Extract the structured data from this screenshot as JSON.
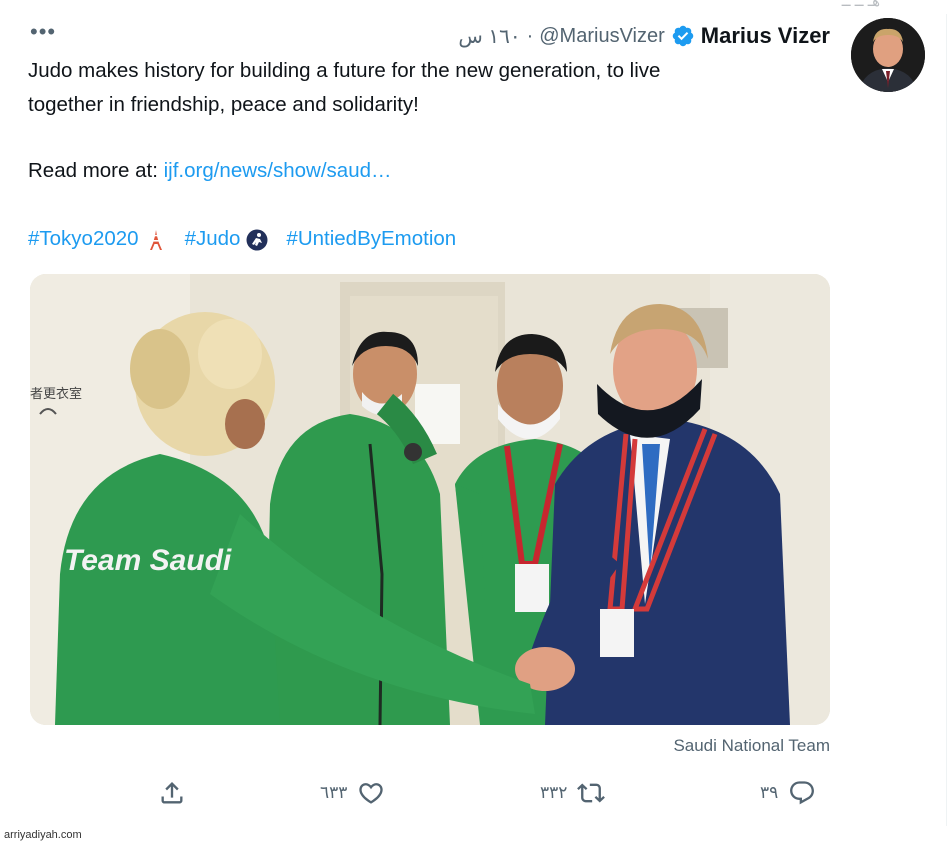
{
  "tweet": {
    "more_icon": "more-horizontal-icon",
    "display_name": "Marius Vizer",
    "verified_icon": "verified-badge-icon",
    "handle": "@MariusVizer",
    "separator": "·",
    "time": "١٦٠ س",
    "text_line1": "Judo makes history for building a future for the new generation, to live",
    "text_line2": "together in friendship, peace and solidarity!",
    "read_more_label": "Read more at:",
    "read_more_link": "ijf.org/news/show/saud…",
    "hashtags": [
      {
        "text": "#Tokyo2020",
        "emoji": "tokyo-tower-emoji"
      },
      {
        "text": "#Judo",
        "emoji": "judo-emoji"
      },
      {
        "text": "#UntiedByEmotion",
        "emoji": ""
      }
    ],
    "photo_jersey_text": "Team Saudi",
    "photo_caption": "Saudi National Team",
    "actions": {
      "reply_count": "٣٩",
      "retweet_count": "٣٣٢",
      "like_count": "٦٣٣",
      "share_icon": "share-icon"
    }
  },
  "watermark": "arriyadiyah.com",
  "colors": {
    "link": "#1d9bf0",
    "secondary_text": "#536471",
    "primary_text": "#0f1419",
    "verified": "#1d9bf0"
  }
}
